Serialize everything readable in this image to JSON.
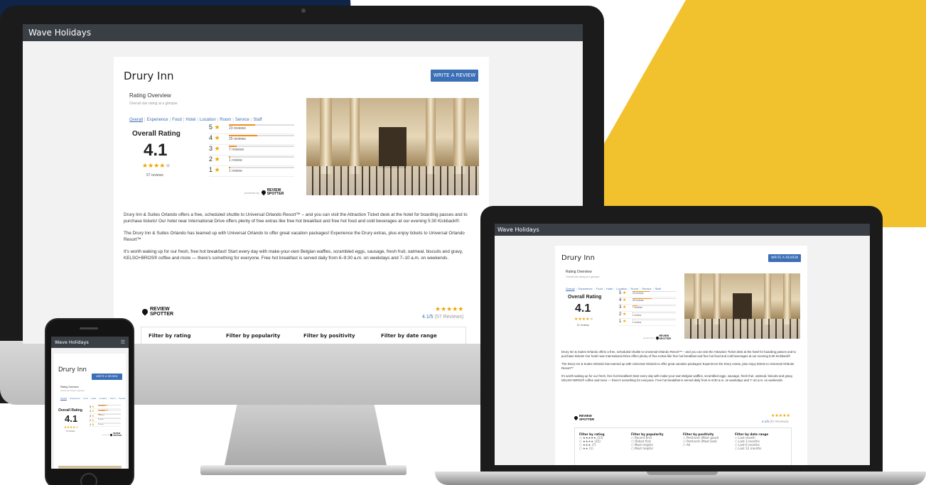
{
  "app": {
    "title": "Wave Holidays"
  },
  "hotel": {
    "name": "Drury Inn",
    "write_review_label": "WRITE A REVIEW"
  },
  "rating_overview": {
    "heading": "Rating Overview",
    "subheading": "Overall star rating at a glimpse",
    "tabs": [
      "Overall",
      "Experience",
      "Food",
      "Hotel",
      "Location",
      "Room",
      "Service",
      "Staff"
    ],
    "overall_label": "Overall Rating",
    "score": "4.1",
    "stars_filled": 4,
    "stars_total": 5,
    "review_count": "57 reviews",
    "breakdown": [
      {
        "stars": "5",
        "count": "23 reviews",
        "fraction": 0.4
      },
      {
        "stars": "4",
        "count": "25 reviews",
        "fraction": 0.44
      },
      {
        "stars": "3",
        "count": "7 reviews",
        "fraction": 0.12
      },
      {
        "stars": "2",
        "count": "1 review",
        "fraction": 0.02
      },
      {
        "stars": "1",
        "count": "1 review",
        "fraction": 0.02
      }
    ],
    "powered_by": "powered by",
    "brand_line1": "REVIEW",
    "brand_line2": "SPOTTER"
  },
  "description": [
    "Drury Inn & Suites Orlando offers a free, scheduled shuttle to Universal Orlando Resort™ – and you can visit the Attraction Ticket desk at the hotel for boarding passes and to purchase tickets! Our hotel near International Drive offers plenty of free extras like free hot breakfast and free hot food and cold beverages at our evening 5:30 Kickback®.",
    "The Drury Inn & Suites Orlando has teamed up with Universal Orlando to offer great vacation packages! Experience the Drury extras, plus enjoy tickets to Universal Orlando Resort™",
    "It's worth waking up for our fresh, free hot breakfast! Start every day with make-your-own Belgian waffles, scrambled eggs, sausage, fresh fruit, oatmeal, biscuits and gravy, KELSO+BROS® coffee and more — there's something for everyone. Free hot breakfast is served daily from 6–9:30 a.m. on weekdays and 7–10 a.m. on weekends."
  ],
  "widget": {
    "stars": "★★★★★",
    "score_line": "4.1/5",
    "reviews_line": "(57 Reviews)",
    "filters": [
      {
        "heading": "Filter by rating",
        "items": [
          "★★★★★ (23)",
          "★★★★ (25)",
          "★★★ (7)",
          "★★ (1)"
        ]
      },
      {
        "heading": "Filter by popularity",
        "items": [
          "Recent first",
          "Oldest first",
          "Most helpful",
          "Most helpful"
        ]
      },
      {
        "heading": "Filter by positivity",
        "items": [
          "Pertinent (Most good)",
          "Pertinent (Most bad)",
          "All"
        ]
      },
      {
        "heading": "Filter by date range",
        "items": [
          "Last month",
          "Last 3 months",
          "Last 6 months",
          "Last 12 months"
        ]
      }
    ]
  },
  "colors": {
    "accent": "#3b6fb6",
    "star": "#f0a500",
    "bar": "#f08c1a",
    "appbar": "#3a3f46",
    "yellow": "#f2c12e",
    "navy": "#0f2447"
  }
}
